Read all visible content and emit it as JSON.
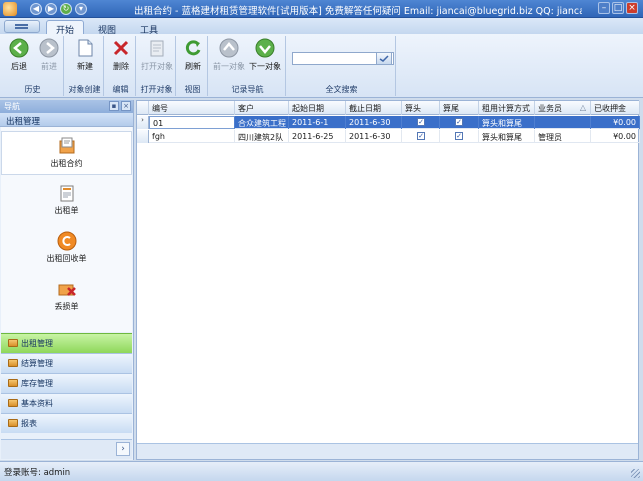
{
  "window": {
    "title": "出租合约 - 蓝格建材租赁管理软件[试用版本] 免费解答任何疑问 Email: jiancai@bluegrid.biz QQ: jiancai...",
    "controls": [
      "minimize",
      "maximize",
      "close"
    ]
  },
  "tabs": [
    {
      "label": "开始",
      "active": true
    },
    {
      "label": "视图",
      "active": false
    },
    {
      "label": "工具",
      "active": false
    }
  ],
  "ribbon": {
    "groups": [
      {
        "label": "历史",
        "buttons": [
          {
            "label": "后退",
            "icon": "back-arrow-icon",
            "enabled": true
          },
          {
            "label": "前进",
            "icon": "forward-arrow-icon",
            "enabled": false
          }
        ]
      },
      {
        "label": "对象创建",
        "buttons": [
          {
            "label": "新建",
            "icon": "new-document-icon",
            "enabled": true
          }
        ]
      },
      {
        "label": "编辑",
        "buttons": [
          {
            "label": "删除",
            "icon": "delete-x-icon",
            "enabled": true
          }
        ]
      },
      {
        "label": "打开对象",
        "buttons": [
          {
            "label": "打开对象",
            "icon": "open-object-icon",
            "enabled": false
          }
        ]
      },
      {
        "label": "视图",
        "buttons": [
          {
            "label": "刷新",
            "icon": "refresh-icon",
            "enabled": true
          }
        ]
      },
      {
        "label": "记录导航",
        "buttons": [
          {
            "label": "前一对象",
            "icon": "previous-object-icon",
            "enabled": false
          },
          {
            "label": "下一对象",
            "icon": "next-object-icon",
            "enabled": true
          }
        ]
      },
      {
        "label": "全文搜索",
        "search_value": ""
      }
    ]
  },
  "navigation": {
    "header": "导航",
    "section": "出租管理",
    "items": [
      {
        "label": "出租合约",
        "icon": "contract-icon",
        "selected": true
      },
      {
        "label": "出租单",
        "icon": "rental-order-icon",
        "selected": false
      },
      {
        "label": "出租回收单",
        "icon": "recovery-order-icon",
        "selected": false
      },
      {
        "label": "丢损单",
        "icon": "loss-order-icon",
        "selected": false
      }
    ],
    "bands": [
      {
        "label": "出租管理",
        "active": true
      },
      {
        "label": "结算管理",
        "active": false
      },
      {
        "label": "库存管理",
        "active": false
      },
      {
        "label": "基本资料",
        "active": false
      },
      {
        "label": "报表",
        "active": false
      }
    ]
  },
  "grid": {
    "columns": [
      "编号",
      "客户",
      "起始日期",
      "截止日期",
      "算头",
      "算尾",
      "租用计算方式",
      "业务员",
      "已收押金"
    ],
    "sort_column": "业务员",
    "rows": [
      {
        "id": "01",
        "customer": "合众建筑工程",
        "start": "2011-6-1",
        "end": "2011-6-30",
        "count_head": true,
        "count_tail": true,
        "method": "算头和算尾",
        "salesperson": "",
        "deposit": "¥0.00",
        "selected": true
      },
      {
        "id": "fgh",
        "customer": "四川建筑2队",
        "start": "2011-6-25",
        "end": "2011-6-30",
        "count_head": true,
        "count_tail": true,
        "method": "算头和算尾",
        "salesperson": "管理员",
        "deposit": "¥0.00",
        "selected": false
      }
    ]
  },
  "status": {
    "login": "登录账号: admin"
  },
  "colors": {
    "titlebar": "#3a6fc4",
    "selected_row": "#3a6fc9",
    "active_band": "#8ed75a"
  }
}
